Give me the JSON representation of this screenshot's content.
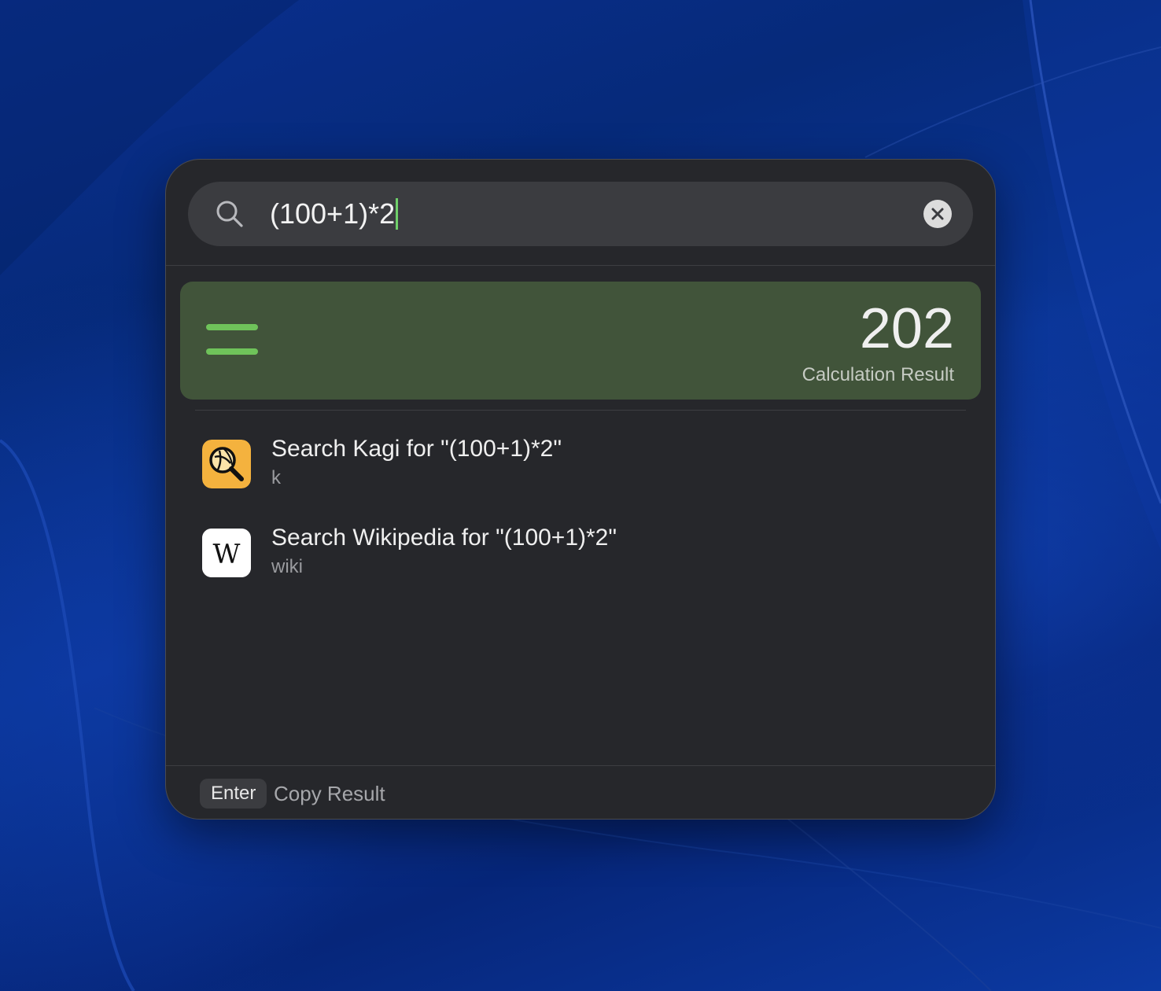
{
  "search": {
    "query": "(100+1)*2",
    "placeholder": ""
  },
  "calculation": {
    "value": "202",
    "label": "Calculation Result"
  },
  "results": [
    {
      "title": "Search Kagi for \"(100+1)*2\"",
      "subtitle": "k",
      "icon": "kagi-icon",
      "icon_color": "#F4B23E"
    },
    {
      "title": "Search Wikipedia for \"(100+1)*2\"",
      "subtitle": "wiki",
      "icon": "wikipedia-icon",
      "icon_color": "#FFFFFF"
    }
  ],
  "footer": {
    "key": "Enter",
    "action": "Copy Result"
  },
  "colors": {
    "accent": "#6FC35A",
    "calc_card": "#41543A",
    "panel": "#26272B"
  },
  "icons": {
    "search": "search-icon",
    "clear": "clear-icon",
    "calculator": "equals-icon",
    "wikipedia_glyph": "W"
  }
}
